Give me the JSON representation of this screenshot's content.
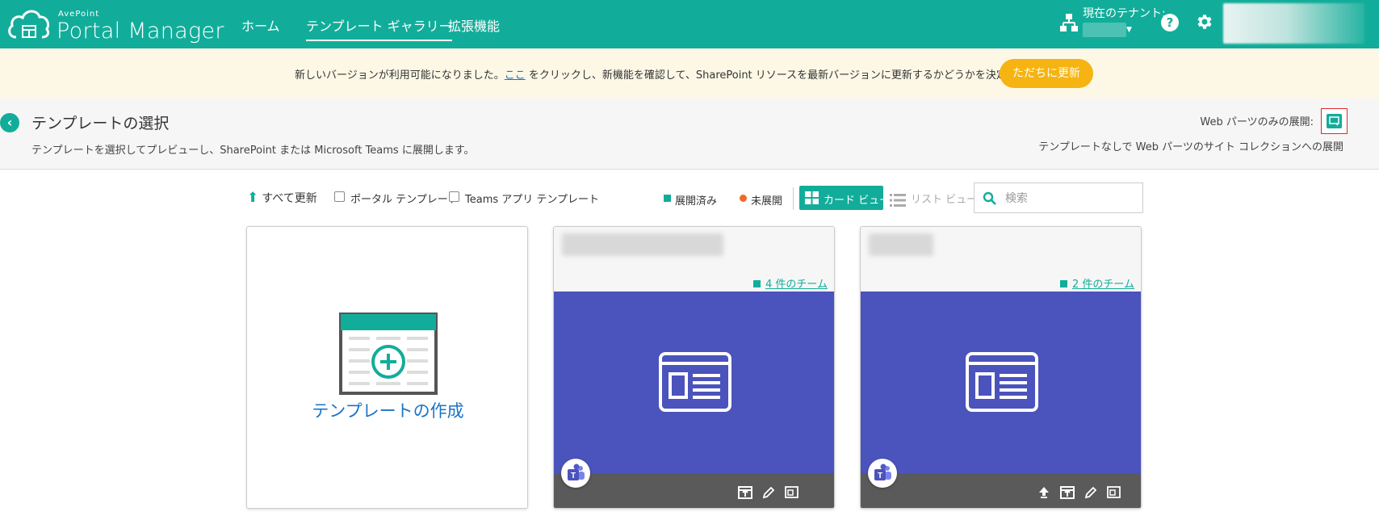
{
  "header": {
    "brand_small": "AvePoint",
    "brand_name": "Portal Manager",
    "nav": [
      {
        "label": "ホーム"
      },
      {
        "label": "テンプレート ギャラリー"
      },
      {
        "label": "拡張機能"
      }
    ],
    "tenant_label": "現在のテナント:",
    "help_label": "?"
  },
  "banner": {
    "text_before": "新しいバージョンが利用可能になりました。",
    "link_text": "ここ",
    "text_after": " をクリックし、新機能を確認して、SharePoint リソースを最新バージョンに更新するかどうかを決定してください。",
    "update_button": "ただちに更新"
  },
  "page": {
    "title": "テンプレートの選択",
    "subtitle": "テンプレートを選択してプレビューし、SharePoint または Microsoft Teams に展開します。",
    "webpart_only_label": "Web パーツのみの展開:",
    "webpart_desc": "テンプレートなしで Web パーツのサイト コレクションへの展開"
  },
  "toolbar": {
    "refresh_all": "すべて更新",
    "portal_template": "ポータル テンプレート",
    "teams_app_template": "Teams アプリ テンプレート",
    "legend_deployed": "展開済み",
    "legend_undeployed": "未展開",
    "card_view": "カード ビュー",
    "list_view": "リスト ビュー",
    "search_placeholder": "検索"
  },
  "cards": {
    "create_label": "テンプレートの作成",
    "items": [
      {
        "teams_link": "4 件のチーム"
      },
      {
        "teams_link": "2 件のチーム"
      }
    ]
  },
  "colors": {
    "brand": "#12ad9a",
    "card_body": "#4b53bc",
    "update": "#f5b412",
    "undeployed": "#ee6a2b"
  }
}
